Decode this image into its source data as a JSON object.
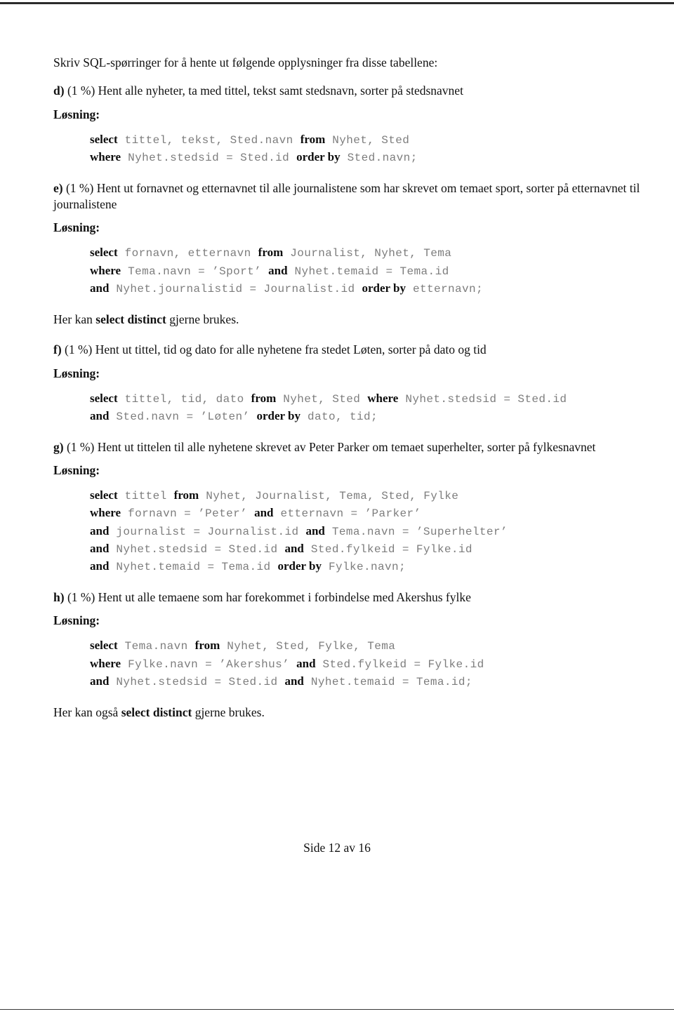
{
  "document": {
    "intro": "Skriv SQL-spørringer for å hente ut følgende opplysninger fra disse tabellene:",
    "solution_label": "Løsning:",
    "footer": "Side 12 av 16"
  },
  "questions": [
    {
      "letter": "d)",
      "points": "(1 %)",
      "prompt": "Hent alle nyheter, ta med tittel, tekst samt stedsnavn, sorter på stedsnavnet",
      "code": [
        [
          {
            "t": "kw",
            "v": "select"
          },
          {
            "t": "mono",
            "v": " tittel, tekst, Sted.navn "
          },
          {
            "t": "kw",
            "v": "from"
          },
          {
            "t": "mono",
            "v": " Nyhet, Sted"
          }
        ],
        [
          {
            "t": "kw",
            "v": "where"
          },
          {
            "t": "mono",
            "v": " Nyhet.stedsid = Sted.id "
          },
          {
            "t": "kw",
            "v": "order by"
          },
          {
            "t": "mono",
            "v": " Sted.navn;"
          }
        ]
      ],
      "note": null
    },
    {
      "letter": "e)",
      "points": "(1 %)",
      "prompt": "Hent ut fornavnet og etternavnet til alle journalistene som har skrevet om temaet sport, sorter på etternavnet til journalistene",
      "code": [
        [
          {
            "t": "kw",
            "v": "select"
          },
          {
            "t": "mono",
            "v": " fornavn, etternavn "
          },
          {
            "t": "kw",
            "v": "from"
          },
          {
            "t": "mono",
            "v": " Journalist, Nyhet, Tema"
          }
        ],
        [
          {
            "t": "kw",
            "v": "where"
          },
          {
            "t": "mono",
            "v": " Tema.navn = ’Sport’ "
          },
          {
            "t": "kw",
            "v": "and"
          },
          {
            "t": "mono",
            "v": " Nyhet.temaid = Tema.id"
          }
        ],
        [
          {
            "t": "kw",
            "v": "and"
          },
          {
            "t": "mono",
            "v": " Nyhet.journalistid = Journalist.id "
          },
          {
            "t": "kw",
            "v": "order by"
          },
          {
            "t": "mono",
            "v": " etternavn;"
          }
        ]
      ],
      "note": {
        "prefix": "Her kan ",
        "bold": "select distinct",
        "suffix": " gjerne brukes."
      }
    },
    {
      "letter": "f)",
      "points": "(1 %)",
      "prompt": "Hent ut tittel, tid og dato for alle nyhetene fra stedet Løten, sorter på dato og tid",
      "code": [
        [
          {
            "t": "kw",
            "v": "select"
          },
          {
            "t": "mono",
            "v": " tittel, tid, dato "
          },
          {
            "t": "kw",
            "v": "from"
          },
          {
            "t": "mono",
            "v": " Nyhet, Sted "
          },
          {
            "t": "kw",
            "v": "where"
          },
          {
            "t": "mono",
            "v": " Nyhet.stedsid = Sted.id"
          }
        ],
        [
          {
            "t": "kw",
            "v": "and"
          },
          {
            "t": "mono",
            "v": " Sted.navn = ’Løten’ "
          },
          {
            "t": "kw",
            "v": "order by"
          },
          {
            "t": "mono",
            "v": " dato, tid;"
          }
        ]
      ],
      "note": null
    },
    {
      "letter": "g)",
      "points": "(1 %)",
      "prompt": "Hent ut tittelen til alle nyhetene skrevet av Peter Parker om temaet superhelter, sorter på fylkesnavnet",
      "code": [
        [
          {
            "t": "kw",
            "v": "select"
          },
          {
            "t": "mono",
            "v": " tittel "
          },
          {
            "t": "kw",
            "v": "from"
          },
          {
            "t": "mono",
            "v": " Nyhet, Journalist, Tema, Sted, Fylke"
          }
        ],
        [
          {
            "t": "kw",
            "v": "where"
          },
          {
            "t": "mono",
            "v": " fornavn = ’Peter’ "
          },
          {
            "t": "kw",
            "v": "and"
          },
          {
            "t": "mono",
            "v": " etternavn = ’Parker’"
          }
        ],
        [
          {
            "t": "kw",
            "v": "and"
          },
          {
            "t": "mono",
            "v": " journalist = Journalist.id "
          },
          {
            "t": "kw",
            "v": "and"
          },
          {
            "t": "mono",
            "v": " Tema.navn = ’Superhelter’"
          }
        ],
        [
          {
            "t": "kw",
            "v": "and"
          },
          {
            "t": "mono",
            "v": " Nyhet.stedsid = Sted.id "
          },
          {
            "t": "kw",
            "v": "and"
          },
          {
            "t": "mono",
            "v": " Sted.fylkeid = Fylke.id"
          }
        ],
        [
          {
            "t": "kw",
            "v": "and"
          },
          {
            "t": "mono",
            "v": " Nyhet.temaid = Tema.id "
          },
          {
            "t": "kw",
            "v": "order by"
          },
          {
            "t": "mono",
            "v": " Fylke.navn;"
          }
        ]
      ],
      "note": null
    },
    {
      "letter": "h)",
      "points": "(1 %)",
      "prompt": "Hent ut alle temaene som har forekommet i forbindelse med Akershus fylke",
      "code": [
        [
          {
            "t": "kw",
            "v": "select"
          },
          {
            "t": "mono",
            "v": " Tema.navn "
          },
          {
            "t": "kw",
            "v": "from"
          },
          {
            "t": "mono",
            "v": " Nyhet, Sted, Fylke, Tema"
          }
        ],
        [
          {
            "t": "kw",
            "v": "where"
          },
          {
            "t": "mono",
            "v": " Fylke.navn = ’Akershus’ "
          },
          {
            "t": "kw",
            "v": "and"
          },
          {
            "t": "mono",
            "v": " Sted.fylkeid = Fylke.id"
          }
        ],
        [
          {
            "t": "kw",
            "v": "and"
          },
          {
            "t": "mono",
            "v": " Nyhet.stedsid = Sted.id "
          },
          {
            "t": "kw",
            "v": "and"
          },
          {
            "t": "mono",
            "v": " Nyhet.temaid = Tema.id;"
          }
        ]
      ],
      "note": {
        "prefix": "Her kan også ",
        "bold": "select distinct",
        "suffix": " gjerne brukes."
      }
    }
  ]
}
